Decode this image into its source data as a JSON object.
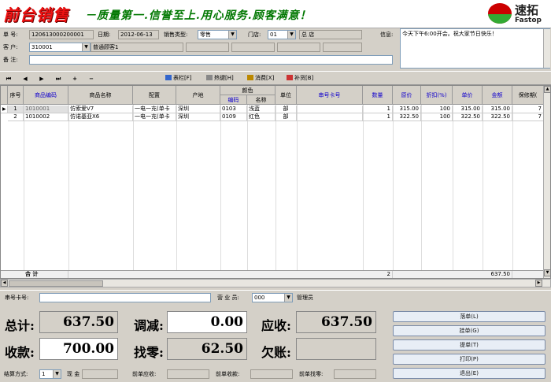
{
  "banner": {
    "title": "前台销售",
    "slogan": "－质量第一.信誉至上.用心服务.顾客满意！",
    "logo_cn": "速拓",
    "logo_en": "Fastop"
  },
  "header": {
    "doc_no_label": "单 号:",
    "doc_no": "120613000200001",
    "date_label": "日期:",
    "date": "2012-06-13",
    "sale_type_label": "销售类型:",
    "sale_type": "零售",
    "store_label": "门店:",
    "store_code": "01",
    "store_name": "总 店",
    "info_label": "信息:",
    "info_text": "今天下午6:00开会。祝大家节日快乐！",
    "customer_label": "客 户:",
    "customer_code": "310001",
    "customer_name": "普通顾客1",
    "remark_label": "备 注:",
    "remark": ""
  },
  "toolbar": {
    "nav": [
      "⏮",
      "◀",
      "▶",
      "⏭",
      "+",
      "−"
    ],
    "buttons": [
      {
        "label": "表栏[F]",
        "icon": "table-icon"
      },
      {
        "label": "热键[H]",
        "icon": "hotkey-icon"
      },
      {
        "label": "消费[X]",
        "icon": "consume-icon"
      },
      {
        "label": "补货[B]",
        "icon": "restock-icon"
      }
    ]
  },
  "table": {
    "headers": {
      "seq": "序号",
      "code": "商品编码",
      "name": "商品名称",
      "config": "配置",
      "origin": "产地",
      "color_group": "颜色",
      "color_code": "编码",
      "color_name": "名称",
      "unit": "单位",
      "serial": "串号卡号",
      "qty": "数量",
      "price": "原价",
      "discount": "折扣(%)",
      "unit_price": "单价",
      "amount": "金额",
      "warranty": "保修期("
    },
    "rows": [
      {
        "seq": "1",
        "code": "1010001",
        "name": "仿索爱V7",
        "config": "一电一充(单卡",
        "origin": "深圳",
        "color_code": "0103",
        "color_name": "浅蓝",
        "unit": "部",
        "serial": "",
        "qty": "1",
        "price": "315.00",
        "discount": "100",
        "unit_price": "315.00",
        "amount": "315.00",
        "warranty": "7"
      },
      {
        "seq": "2",
        "code": "1010002",
        "name": "仿诺基亚X6",
        "config": "一电一充(单卡",
        "origin": "深圳",
        "color_code": "0109",
        "color_name": "红色",
        "unit": "部",
        "serial": "",
        "qty": "1",
        "price": "322.50",
        "discount": "100",
        "unit_price": "322.50",
        "amount": "322.50",
        "warranty": "7"
      }
    ],
    "footer": {
      "label": "合 计",
      "qty": "2",
      "amount": "637.50"
    }
  },
  "bottom": {
    "serial_label": "串号卡号:",
    "serial": "",
    "salesperson_label": "营 业 员:",
    "salesperson_code": "000",
    "salesperson_name": "管理员",
    "total_label": "总计:",
    "total": "637.50",
    "adjust_label": "调减:",
    "adjust": "0.00",
    "receivable_label": "应收:",
    "receivable": "637.50",
    "received_label": "收款:",
    "received": "700.00",
    "change_label": "找零:",
    "change": "62.50",
    "owed_label": "欠账:",
    "owed": "",
    "settle_label": "结算方式:",
    "settle_code": "1",
    "settle_name": "现 金",
    "prev_recv_label": "前单应收:",
    "prev_recv": "",
    "prev_got_label": "前单收款:",
    "prev_got": "",
    "prev_change_label": "前单找零:",
    "prev_change": "",
    "buttons": [
      "落单(L)",
      "挂单(G)",
      "提单(T)",
      "打印(P)",
      "退出(E)"
    ]
  }
}
